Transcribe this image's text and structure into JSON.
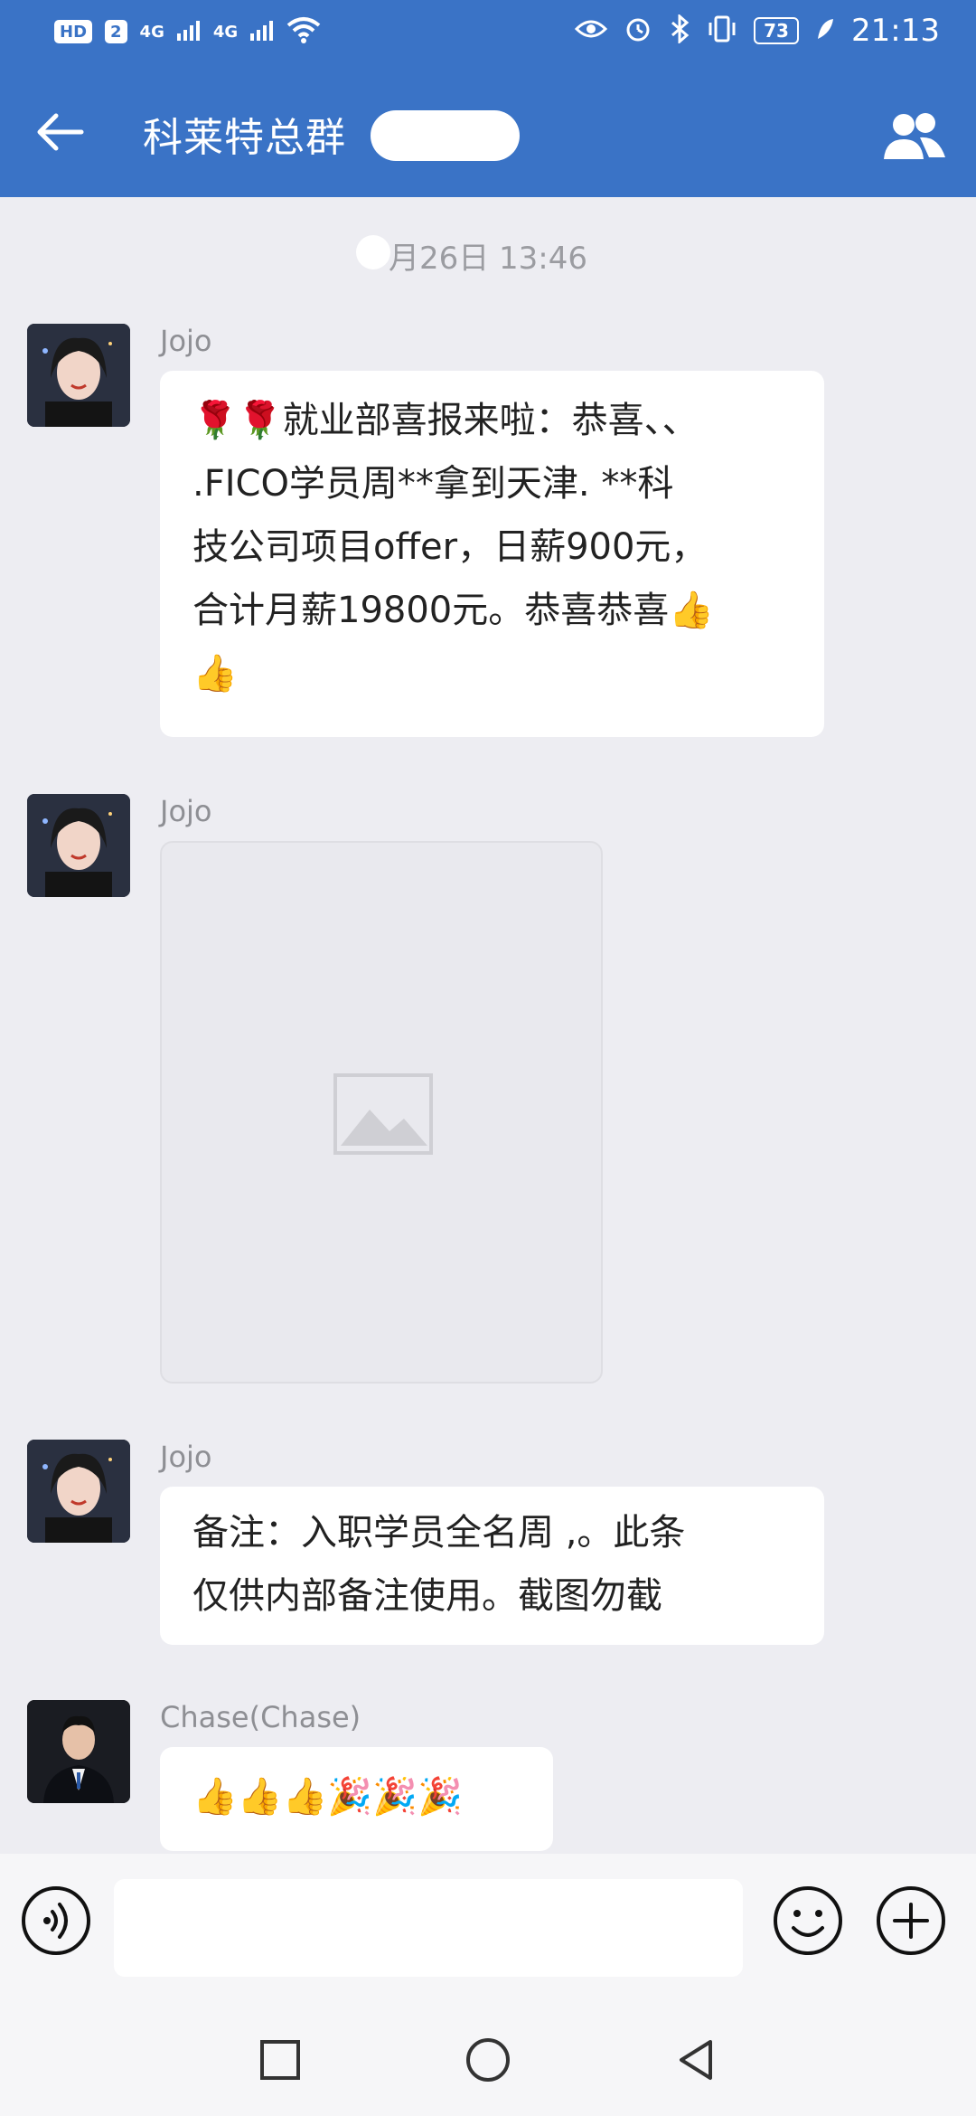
{
  "status_bar": {
    "left_items": [
      "HD",
      "2",
      "4G",
      "4G"
    ],
    "battery": "73",
    "time": "21:13"
  },
  "header": {
    "title": "科莱特总群"
  },
  "chat": {
    "timestamp": "月26日 13:46",
    "messages": [
      {
        "sender": "Jojo",
        "type": "text",
        "lines": [
          "🌹🌹就业部喜报来啦：恭喜、、",
          ".FICO学员周**拿到天津. **科",
          "技公司项目offer，日薪900元，",
          "合计月薪19800元。恭喜恭喜👍",
          "👍"
        ]
      },
      {
        "sender": "Jojo",
        "type": "image"
      },
      {
        "sender": "Jojo",
        "type": "text",
        "lines": [
          "备注：入职学员全名周 ,。此条",
          "仅供内部备注使用。截图勿截"
        ]
      },
      {
        "sender": "Chase(Chase)",
        "type": "text",
        "lines": [
          "👍👍👍🎉🎉🎉"
        ]
      }
    ]
  },
  "input": {
    "value": "",
    "placeholder": ""
  },
  "colors": {
    "header_bg": "#3a73c6",
    "chat_bg": "#ededf2",
    "bubble_bg": "#ffffff"
  },
  "icons": {
    "back": "back-arrow-icon",
    "members": "group-members-icon",
    "voice": "voice-input-icon",
    "emoji": "emoji-icon",
    "plus": "plus-icon"
  }
}
